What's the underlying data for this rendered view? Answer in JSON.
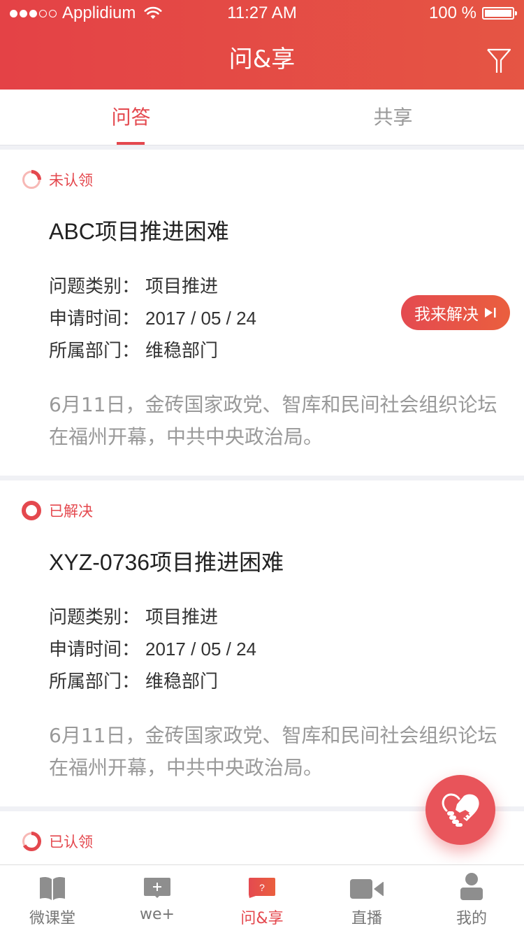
{
  "status_bar": {
    "signal_filled": 3,
    "signal_total": 5,
    "carrier": "Applidium",
    "time": "11:27 AM",
    "battery": "100 %",
    "battery_level": 1.0
  },
  "header": {
    "title": "问&享",
    "filter_icon": "filter-icon"
  },
  "tabs": [
    {
      "label": "问答",
      "active": true
    },
    {
      "label": "共享",
      "active": false
    }
  ],
  "cards": [
    {
      "status": "未认领",
      "status_icon": "ring-partial-icon",
      "title": "ABC项目推进困难",
      "meta": [
        {
          "label": "问题类别：",
          "value": "项目推进"
        },
        {
          "label": "申请时间：",
          "value": "2017 / 05 / 24"
        },
        {
          "label": "所属部门：",
          "value": "维稳部门"
        }
      ],
      "description": "6月11日，金砖国家政党、智库和民间社会组织论坛在福州开幕，中共中央政治局。",
      "action_label": "我来解决"
    },
    {
      "status": "已解决",
      "status_icon": "ring-full-icon",
      "title": "XYZ-0736项目推进困难",
      "meta": [
        {
          "label": "问题类别：",
          "value": "项目推进"
        },
        {
          "label": "申请时间：",
          "value": "2017 / 05 / 24"
        },
        {
          "label": "所属部门：",
          "value": "维稳部门"
        }
      ],
      "description": "6月11日，金砖国家政党、智库和民间社会组织论坛在福州开幕，中共中央政治局。"
    },
    {
      "status": "已认领",
      "status_icon": "ring-mostly-icon"
    }
  ],
  "fab": {
    "icon": "handshake-heart-icon"
  },
  "bottom_nav": [
    {
      "label": "微课堂",
      "icon": "book-icon",
      "active": false
    },
    {
      "label": "we+",
      "icon": "chat-plus-icon",
      "active": false
    },
    {
      "label": "问&享",
      "icon": "question-bubble-icon",
      "active": true
    },
    {
      "label": "直播",
      "icon": "video-camera-icon",
      "active": false
    },
    {
      "label": "我的",
      "icon": "user-icon",
      "active": false
    }
  ],
  "colors": {
    "accent": "#e4484e",
    "header_start": "#e44246",
    "header_end": "#e55544",
    "muted_text": "#999999",
    "icon_gray": "#8e8e8e"
  }
}
